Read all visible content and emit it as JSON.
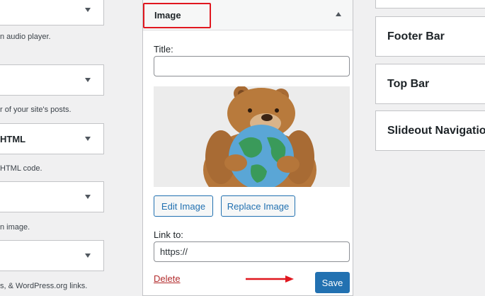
{
  "available_widgets": [
    {
      "title": "",
      "description": "n audio player."
    },
    {
      "title": "",
      "description": "r of your site's posts."
    },
    {
      "title": "HTML",
      "description": "HTML code."
    },
    {
      "title": "",
      "description": "n image."
    },
    {
      "title": "",
      "description": "s, & WordPress.org links."
    }
  ],
  "image_widget": {
    "title": "Image",
    "title_label": "Title:",
    "title_value": "",
    "edit_image_label": "Edit Image",
    "replace_image_label": "Replace Image",
    "link_label": "Link to:",
    "link_value": "https://",
    "delete_label": "Delete",
    "save_label": "Save"
  },
  "sidebars": [
    {
      "title": "Footer Bar"
    },
    {
      "title": "Top Bar"
    },
    {
      "title": "Slideout Navigation"
    }
  ],
  "colors": {
    "accent": "#2271b1",
    "highlight": "#e0171f",
    "delete": "#b32d2e"
  }
}
